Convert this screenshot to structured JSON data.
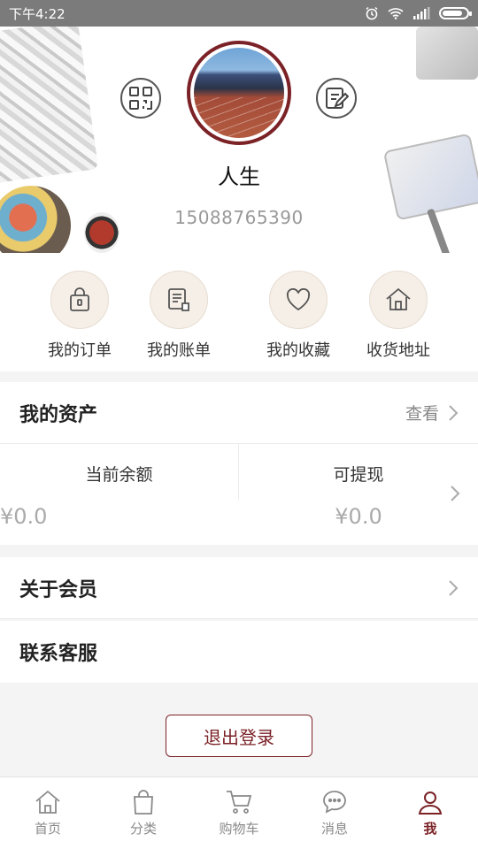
{
  "status_bar": {
    "time": "下午4:22",
    "battery_fraction": 0.85
  },
  "profile": {
    "name": "人生",
    "phone": "15088765390"
  },
  "quick_menu": [
    {
      "label": "我的订单",
      "icon": "shopping-bag-icon"
    },
    {
      "label": "我的账单",
      "icon": "bill-icon"
    },
    {
      "label": "我的收藏",
      "icon": "heart-icon"
    },
    {
      "label": "收货地址",
      "icon": "house-icon"
    }
  ],
  "assets": {
    "title": "我的资产",
    "view_label": "查看",
    "balance_label": "当前余额",
    "balance_value": "¥0.0",
    "withdraw_label": "可提现",
    "withdraw_value": "¥0.0"
  },
  "rows": {
    "member": "关于会员",
    "service": "联系客服"
  },
  "logout_label": "退出登录",
  "tabs": [
    {
      "label": "首页",
      "icon": "home-icon"
    },
    {
      "label": "分类",
      "icon": "bag-icon"
    },
    {
      "label": "购物车",
      "icon": "cart-icon"
    },
    {
      "label": "消息",
      "icon": "message-icon"
    },
    {
      "label": "我",
      "icon": "user-icon",
      "active": true
    }
  ],
  "colors": {
    "accent": "#7b2227",
    "icon_bg": "#f6efe7"
  }
}
